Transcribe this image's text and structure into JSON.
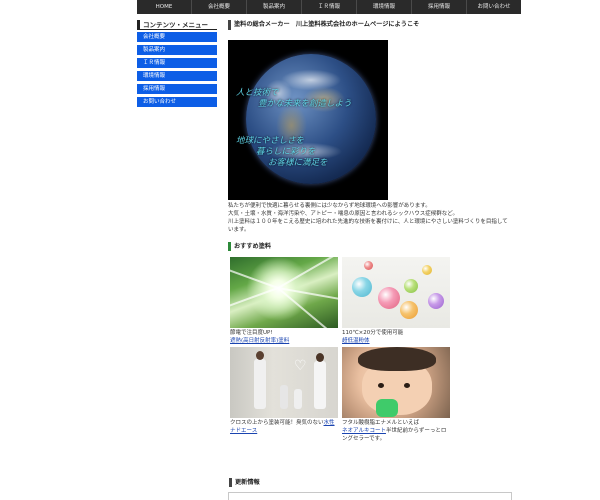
{
  "nav": {
    "items": [
      "HOME",
      "会社概要",
      "製品案内",
      "ＩＲ情報",
      "環境情報",
      "採用情報",
      "お問い合わせ"
    ]
  },
  "sidebar": {
    "title": "コンテンツ・メニュー",
    "items": [
      "会社概要",
      "製品案内",
      "ＩＲ情報",
      "環境情報",
      "採用情報",
      "お問い合わせ"
    ]
  },
  "main": {
    "title": "塗料の総合メーカー　川上塗料株式会社のホームページにようこそ",
    "hero_lines": [
      "人と技術で",
      "豊かな未来を創造しよう",
      "地球にやさしさを",
      "暮らしに彩りを",
      "お客様に満足を"
    ],
    "intro": [
      "私たちが便利で快適に暮らせる裏側には少なからず地球環境への影響があります。",
      "大気・土壌・水質・海洋汚染や、アトピー・喘息の原因と言われるシックハウス症候群など。",
      "川上塗料は１００年をこえる歴史に培われた先進的な技術を裏付けに、人と環境にやさしい塗料づくりを目指しています。"
    ]
  },
  "recommend": {
    "title": "おすすめ塗料",
    "cards": [
      {
        "text": "節電で注目度UP!",
        "link": "遮熱(高日射反射率)塗料"
      },
      {
        "text": "110℃×20分で使用可能",
        "link": "超低温粉体"
      },
      {
        "text": "クロスの上から塗装可能！臭気のない",
        "link": "水性ナドエース"
      },
      {
        "text": "フタル酸樹脂エナメルといえば",
        "link": "ネオアルキコート",
        "text2": "半世紀前からずーっとロングセラーです。"
      }
    ]
  },
  "updates": {
    "title": "更新情報"
  },
  "colors": {
    "nav_bg": "#2a2a2a",
    "sidebar_item_bg": "#0d5ee6",
    "link": "#1a44b0",
    "section_accent": "#2d8a3a"
  }
}
